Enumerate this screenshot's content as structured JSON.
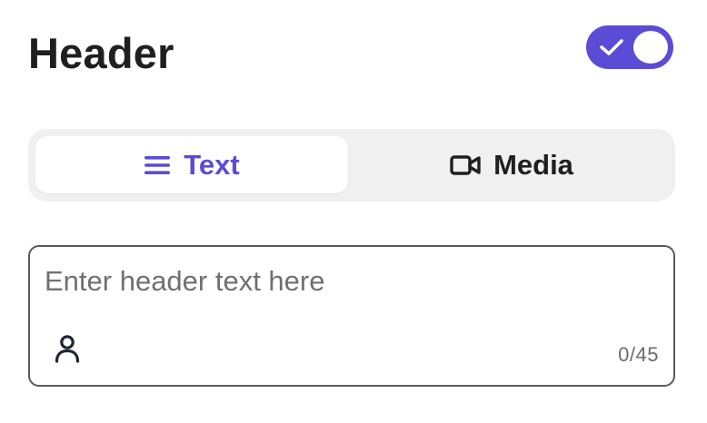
{
  "header": {
    "title": "Header",
    "toggle_on": true
  },
  "tabs": [
    {
      "label": "Text",
      "icon": "lines-icon",
      "active": true
    },
    {
      "label": "Media",
      "icon": "video-camera-icon",
      "active": false
    }
  ],
  "input": {
    "value": "",
    "placeholder": "Enter header text here",
    "counter": "0/45",
    "icon": "person-icon"
  },
  "colors": {
    "accent": "#5b4cd6",
    "segment_bg": "#f0f0f0",
    "text_dark": "#1f1f1f",
    "placeholder": "#707070",
    "border": "#5a5a5a"
  }
}
